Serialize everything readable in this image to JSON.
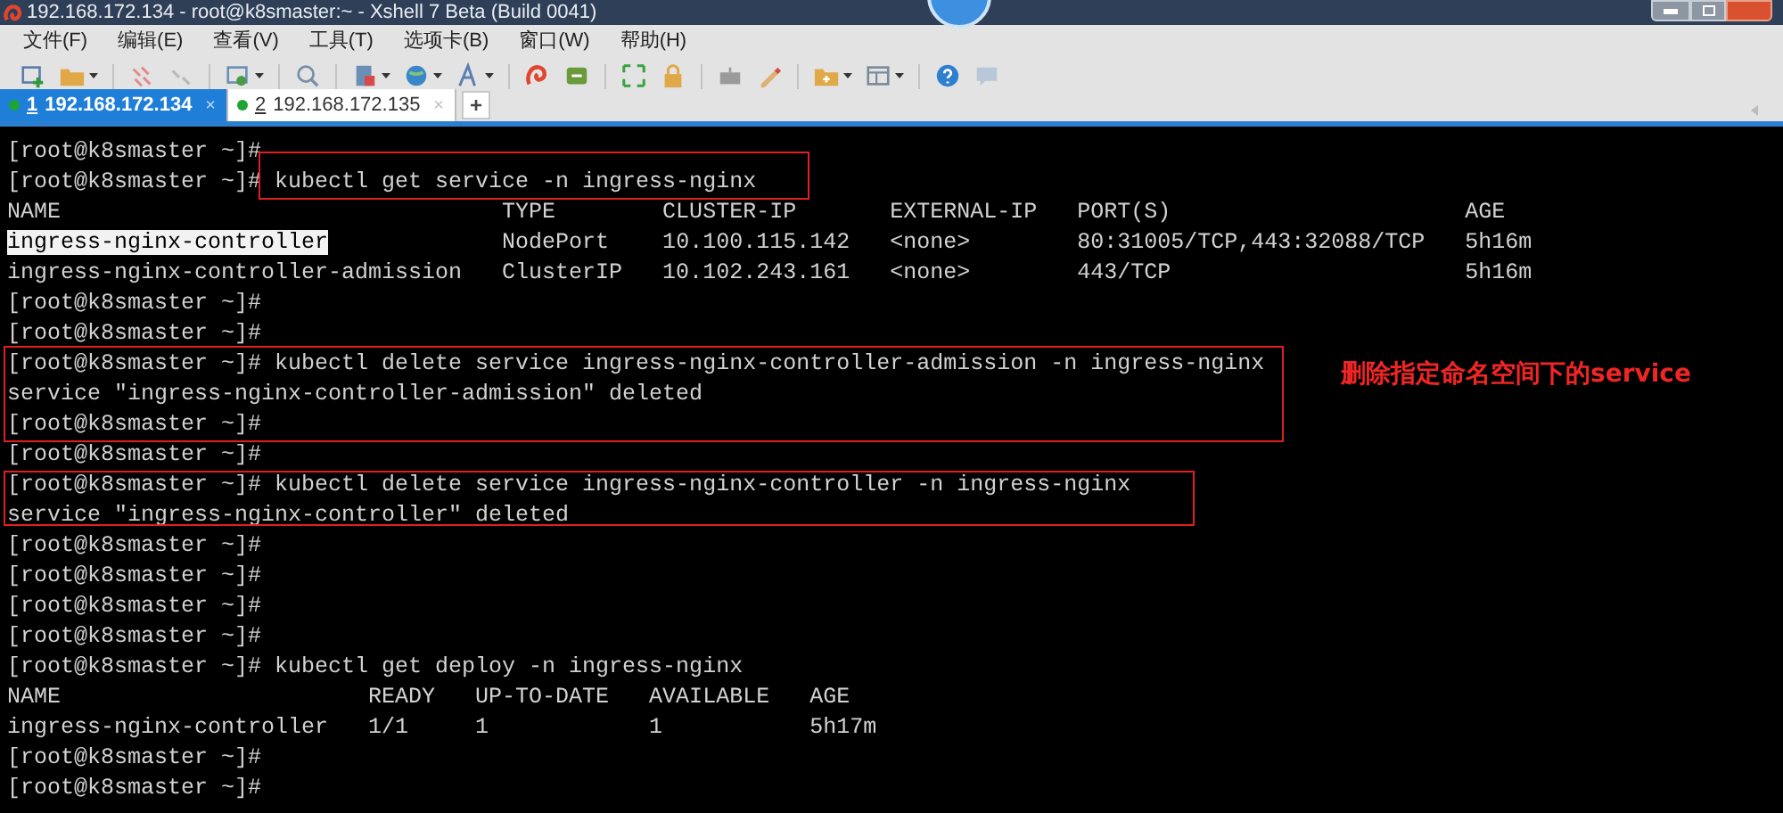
{
  "window": {
    "title": "192.168.172.134 - root@k8smaster:~ - Xshell 7 Beta (Build 0041)"
  },
  "menu": [
    "文件(F)",
    "编辑(E)",
    "查看(V)",
    "工具(T)",
    "选项卡(B)",
    "窗口(W)",
    "帮助(H)"
  ],
  "tabs": [
    {
      "number": "1",
      "label": "192.168.172.134",
      "selected": true,
      "close": "×"
    },
    {
      "number": "2",
      "label": "192.168.172.135",
      "selected": false,
      "close": "×"
    }
  ],
  "new_tab": "+",
  "terminal": {
    "lines": [
      {
        "text": "[root@k8smaster ~]#"
      },
      {
        "text": "[root@k8smaster ~]# kubectl get service -n ingress-nginx"
      },
      {
        "text": "NAME                                 TYPE        CLUSTER-IP       EXTERNAL-IP   PORT(S)                      AGE"
      },
      {
        "segments": [
          {
            "text": "ingress-nginx-controller",
            "selected": true
          },
          {
            "text": "             NodePort    10.100.115.142   <none>        80:31005/TCP,443:32088/TCP   5h16m",
            "selected": false
          }
        ]
      },
      {
        "text": "ingress-nginx-controller-admission   ClusterIP   10.102.243.161   <none>        443/TCP                      5h16m"
      },
      {
        "text": "[root@k8smaster ~]#"
      },
      {
        "text": "[root@k8smaster ~]#"
      },
      {
        "text": "[root@k8smaster ~]# kubectl delete service ingress-nginx-controller-admission -n ingress-nginx"
      },
      {
        "text": "service \"ingress-nginx-controller-admission\" deleted"
      },
      {
        "text": "[root@k8smaster ~]#"
      },
      {
        "text": "[root@k8smaster ~]#"
      },
      {
        "text": "[root@k8smaster ~]# kubectl delete service ingress-nginx-controller -n ingress-nginx"
      },
      {
        "text": "service \"ingress-nginx-controller\" deleted"
      },
      {
        "text": "[root@k8smaster ~]#"
      },
      {
        "text": "[root@k8smaster ~]#"
      },
      {
        "text": "[root@k8smaster ~]#"
      },
      {
        "text": "[root@k8smaster ~]#"
      },
      {
        "text": "[root@k8smaster ~]# kubectl get deploy -n ingress-nginx"
      },
      {
        "text": "NAME                       READY   UP-TO-DATE   AVAILABLE   AGE"
      },
      {
        "text": "ingress-nginx-controller   1/1     1            1           5h17m"
      },
      {
        "text": "[root@k8smaster ~]#"
      },
      {
        "text": "[root@k8smaster ~]#"
      }
    ],
    "annotations": [
      {
        "kind": "box"
      },
      {
        "kind": "box",
        "note": "删除指定命名空间下的service"
      },
      {
        "kind": "box"
      }
    ]
  }
}
